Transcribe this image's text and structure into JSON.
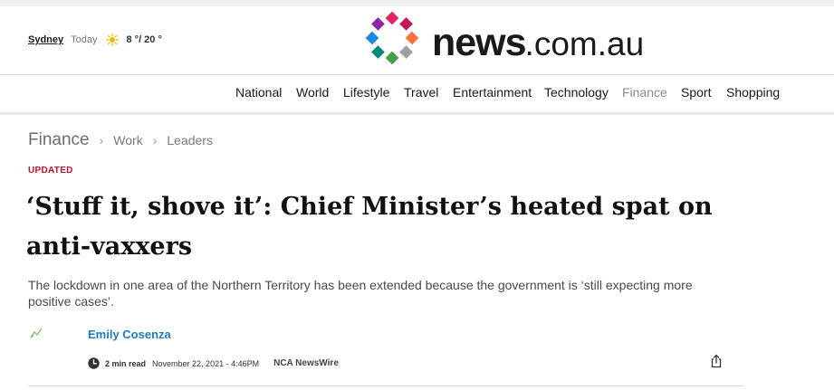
{
  "weather": {
    "city": "Sydney",
    "day": "Today",
    "icon": "sun-icon",
    "temperature": "8 °/ 20 °"
  },
  "logo": {
    "wordmark": "news",
    "domain": ".com.au",
    "colors": [
      "#e91e63",
      "#c2185b",
      "#ff7043",
      "#9e9e9e",
      "#43a047",
      "#00897b",
      "#1e88e5",
      "#8e24aa"
    ]
  },
  "nav": {
    "items": [
      "National",
      "World",
      "Lifestyle",
      "Travel",
      "Entertainment",
      "Technology",
      "Finance",
      "Sport",
      "Shopping"
    ],
    "active": "Finance"
  },
  "breadcrumb": {
    "section": "Finance",
    "items": [
      "Work",
      "Leaders"
    ]
  },
  "article": {
    "status": "UPDATED",
    "headline": "‘Stuff it, shove it’: Chief Minister’s heated spat on anti-vaxxers",
    "standfirst": "The lockdown in one area of the Northern Territory has been extended because the government is ‘still expecting more positive cases’.",
    "author": "Emily Cosenza",
    "read_time": "2 min read",
    "date": "November 22, 2021 - 4:46PM",
    "source": "NCA NewsWire",
    "share_icon": "share-icon"
  },
  "colors": {
    "updated": "#c8102e",
    "author_link": "#1f7bc4"
  }
}
